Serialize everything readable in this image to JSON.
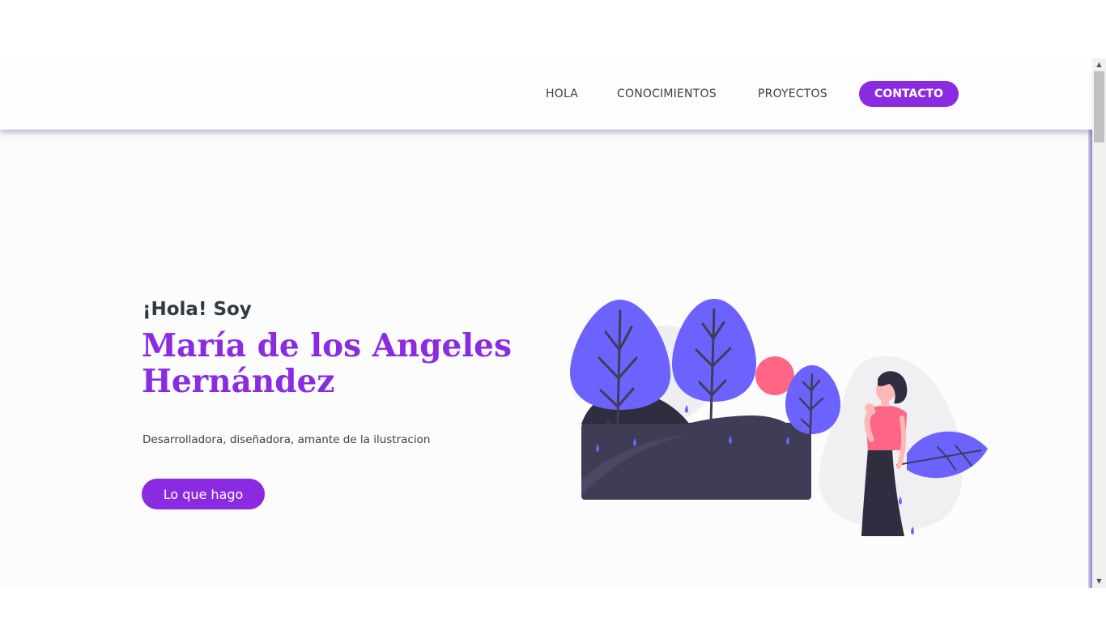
{
  "nav": {
    "items": [
      {
        "label": "HOLA"
      },
      {
        "label": "CONOCIMIENTOS"
      },
      {
        "label": "PROYECTOS"
      }
    ],
    "contact_label": "CONTACTO"
  },
  "hero": {
    "greeting": "¡Hola! Soy",
    "name_line1": "María de los Angeles",
    "name_line2": "Hernández",
    "tagline": "Desarrolladora, diseñadora, amante de la ilustracion",
    "cta_label": "Lo que hago"
  },
  "icons": {
    "scroll_up": "▲",
    "scroll_down": "▼"
  },
  "colors": {
    "accent": "#8a2be2",
    "text_dark": "#2f3a45",
    "tree": "#6c63ff",
    "hill": "#3f3d56",
    "sun": "#ff6584",
    "shirt": "#ff6584",
    "page_bg": "#fcfcfc"
  }
}
